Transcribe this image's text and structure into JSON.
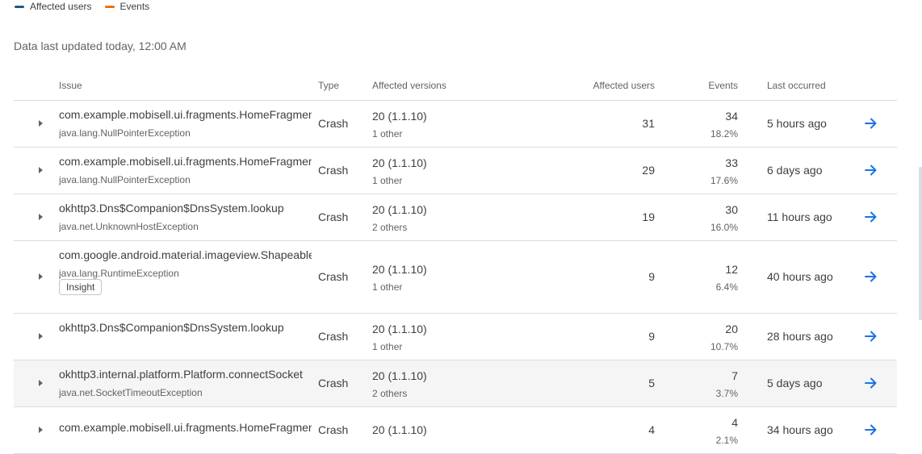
{
  "legend": [
    {
      "label": "Affected users",
      "color": "#1a5a8a"
    },
    {
      "label": "Events",
      "color": "#e8710a"
    }
  ],
  "updated_text": "Data last updated today, 12:00 AM",
  "columns": {
    "issue": "Issue",
    "type": "Type",
    "versions": "Affected versions",
    "users": "Affected users",
    "events": "Events",
    "last": "Last occurred"
  },
  "rows": [
    {
      "title": "com.example.mobisell.ui.fragments.HomeFragment",
      "exception": "java.lang.NullPointerException",
      "type": "Crash",
      "version": "20 (1.1.10)",
      "others": "1 other",
      "users": "31",
      "events": "34",
      "percent": "18.2%",
      "last": "5 hours ago"
    },
    {
      "title": "com.example.mobisell.ui.fragments.HomeFragment",
      "exception": "java.lang.NullPointerException",
      "type": "Crash",
      "version": "20 (1.1.10)",
      "others": "1 other",
      "users": "29",
      "events": "33",
      "percent": "17.6%",
      "last": "6 days ago"
    },
    {
      "title": "okhttp3.Dns$Companion$DnsSystem.lookup",
      "exception": "java.net.UnknownHostException",
      "type": "Crash",
      "version": "20 (1.1.10)",
      "others": "2 others",
      "users": "19",
      "events": "30",
      "percent": "16.0%",
      "last": "11 hours ago"
    },
    {
      "title": "com.google.android.material.imageview.ShapeableImageView",
      "exception": "java.lang.RuntimeException",
      "badge": "Insight",
      "type": "Crash",
      "version": "20 (1.1.10)",
      "others": "1 other",
      "users": "9",
      "events": "12",
      "percent": "6.4%",
      "last": "40 hours ago"
    },
    {
      "title": "okhttp3.Dns$Companion$DnsSystem.lookup",
      "exception": "",
      "type": "Crash",
      "version": "20 (1.1.10)",
      "others": "1 other",
      "users": "9",
      "events": "20",
      "percent": "10.7%",
      "last": "28 hours ago"
    },
    {
      "title": "okhttp3.internal.platform.Platform.connectSocket",
      "exception": "java.net.SocketTimeoutException",
      "type": "Crash",
      "version": "20 (1.1.10)",
      "others": "2 others",
      "users": "5",
      "events": "7",
      "percent": "3.7%",
      "last": "5 days ago"
    },
    {
      "title": "com.example.mobisell.ui.fragments.HomeFragment",
      "exception": "",
      "type": "Crash",
      "version": "20 (1.1.10)",
      "others": "",
      "users": "4",
      "events": "4",
      "percent": "2.1%",
      "last": "34 hours ago"
    }
  ],
  "icons": {
    "expand": "expand-triangle-icon",
    "open": "arrow-right-icon"
  },
  "colors": {
    "accent": "#1a73e8"
  }
}
